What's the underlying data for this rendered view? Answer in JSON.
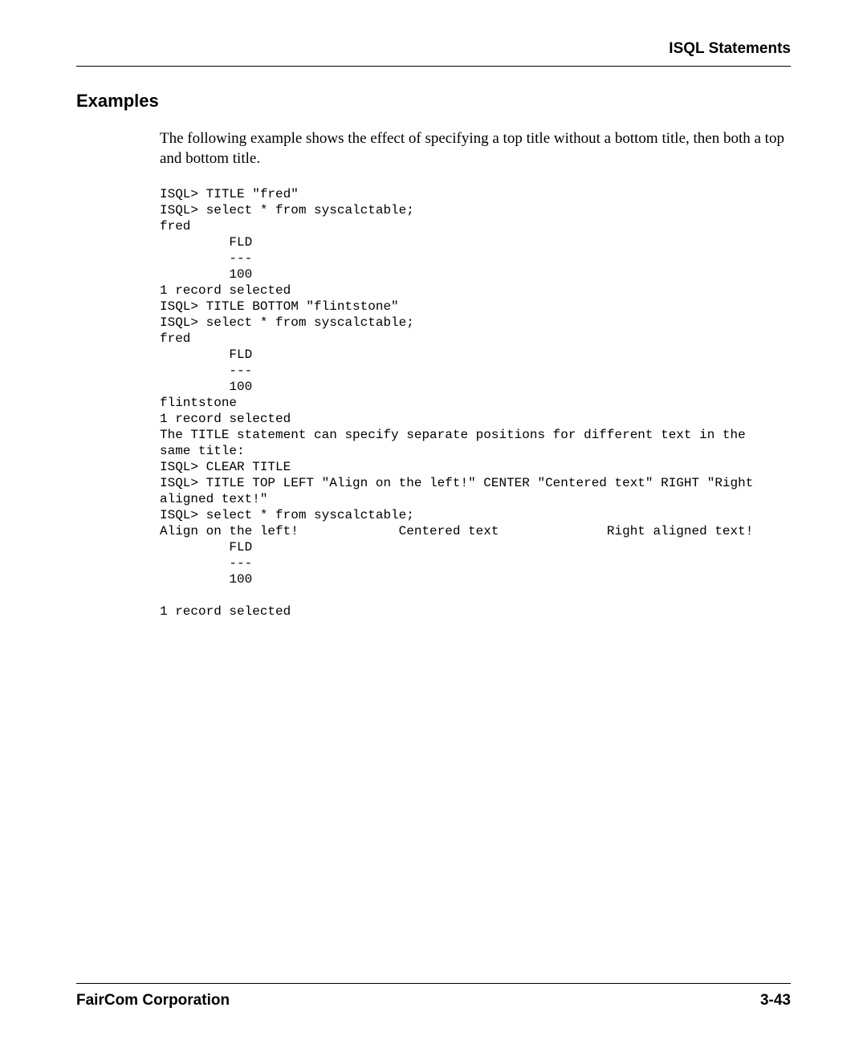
{
  "header": {
    "title": "ISQL Statements"
  },
  "section": {
    "heading": "Examples",
    "paragraph": "The following example shows the effect of specifying a top title without a bottom title, then both a top and bottom title."
  },
  "code": {
    "text": "ISQL> TITLE \"fred\"\nISQL> select * from syscalctable;\nfred\n         FLD\n         ---\n         100\n1 record selected\nISQL> TITLE BOTTOM \"flintstone\"\nISQL> select * from syscalctable;\nfred\n         FLD\n         ---\n         100\nflintstone\n1 record selected\nThe TITLE statement can specify separate positions for different text in the \nsame title:\nISQL> CLEAR TITLE\nISQL> TITLE TOP LEFT \"Align on the left!\" CENTER \"Centered text\" RIGHT \"Right \naligned text!\"\nISQL> select * from syscalctable;\nAlign on the left!             Centered text              Right aligned text!\n         FLD\n         ---\n         100\n\n1 record selected"
  },
  "footer": {
    "company": "FairCom Corporation",
    "page": "3-43"
  }
}
